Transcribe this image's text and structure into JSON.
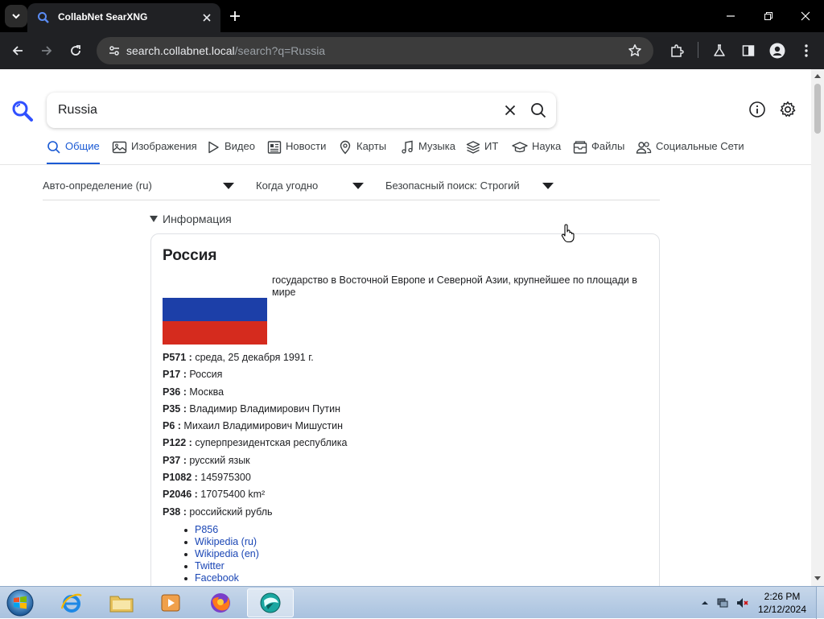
{
  "browser": {
    "tab_title": "CollabNet SearXNG",
    "url_host": "search.collabnet.local",
    "url_path": "/search?q=Russia"
  },
  "search": {
    "query": "Russia"
  },
  "categories": [
    {
      "label": "Общие",
      "icon": "search-icon",
      "active": true
    },
    {
      "label": "Изображения",
      "icon": "image-icon"
    },
    {
      "label": "Видео",
      "icon": "play-icon"
    },
    {
      "label": "Новости",
      "icon": "newspaper-icon"
    },
    {
      "label": "Карты",
      "icon": "map-pin-icon"
    },
    {
      "label": "Музыка",
      "icon": "music-note-icon"
    },
    {
      "label": "ИТ",
      "icon": "layers-icon"
    },
    {
      "label": "Наука",
      "icon": "graduation-cap-icon"
    },
    {
      "label": "Файлы",
      "icon": "file-box-icon"
    },
    {
      "label": "Социальные Сети",
      "icon": "people-icon"
    }
  ],
  "filters": {
    "language": "Авто-определение (ru)",
    "time": "Когда угодно",
    "safesearch": "Безопасный поиск: Строгий"
  },
  "infobox": {
    "toggle_label": "Информация",
    "title": "Россия",
    "description": "государство в Восточной Европе и Северной Азии, крупнейшее по площади в мире",
    "attributes": [
      {
        "key": "P571 :",
        "value": "среда, 25 декабря 1991 г."
      },
      {
        "key": "P17 :",
        "value": "Россия"
      },
      {
        "key": "P36 :",
        "value": "Москва"
      },
      {
        "key": "P35 :",
        "value": "Владимир Владимирович Путин"
      },
      {
        "key": "P6 :",
        "value": "Михаил Владимирович Мишустин"
      },
      {
        "key": "P122 :",
        "value": "суперпрезидентская республика"
      },
      {
        "key": "P37 :",
        "value": "русский язык"
      },
      {
        "key": "P1082 :",
        "value": "145975300"
      },
      {
        "key": "P2046 :",
        "value": "17075400 km²"
      },
      {
        "key": "P38 :",
        "value": "российский рубль"
      }
    ],
    "links": [
      "P856",
      "Wikipedia (ru)",
      "Wikipedia (en)",
      "Twitter",
      "Facebook"
    ]
  },
  "taskbar": {
    "time": "2:26 PM",
    "date": "12/12/2024"
  },
  "colors": {
    "accent": "#1a5ad4",
    "link": "#1a46b5",
    "flag_white": "#ffffff",
    "flag_blue": "#1c3fa8",
    "flag_red": "#d52b1e"
  }
}
